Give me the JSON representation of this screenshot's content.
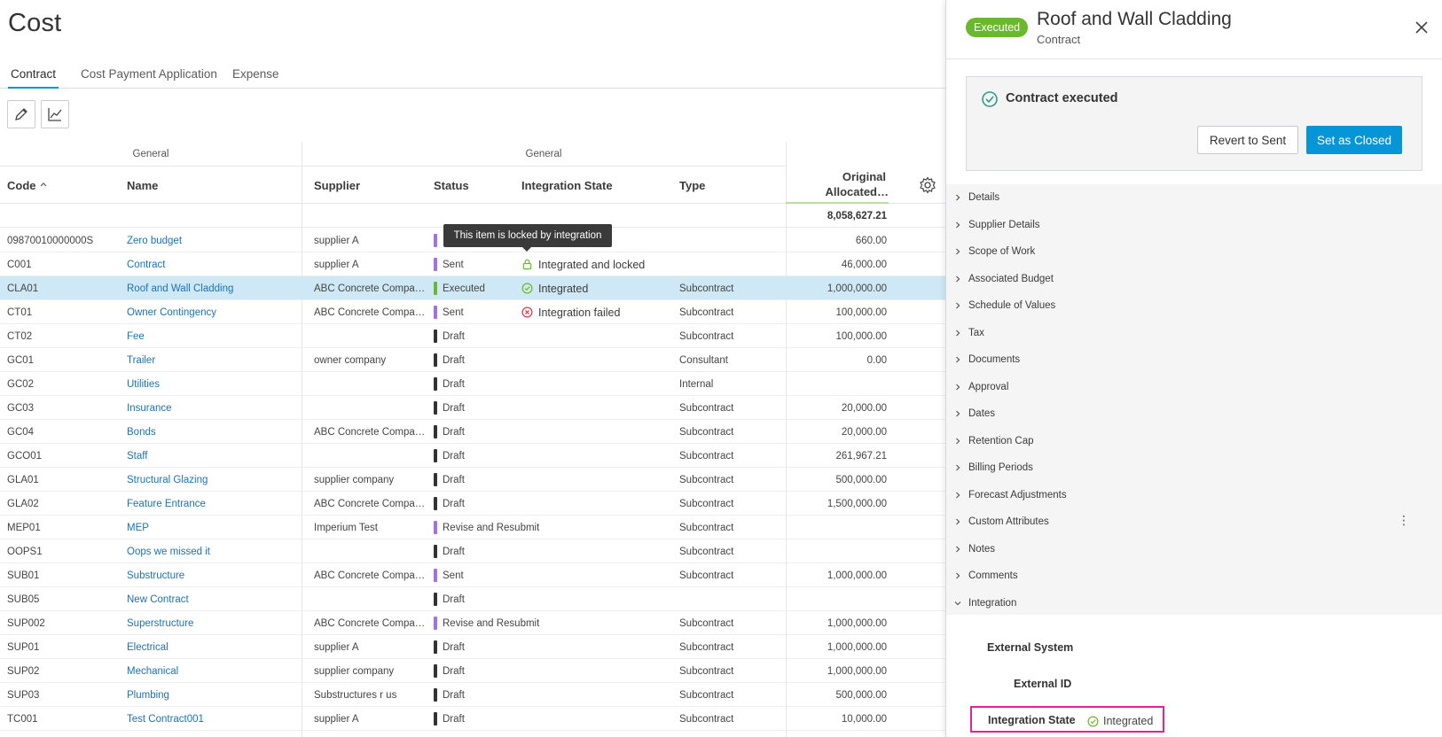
{
  "page": {
    "title": "Cost"
  },
  "tabs": [
    {
      "label": "Contract",
      "active": true
    },
    {
      "label": "Cost Payment Application",
      "active": false
    },
    {
      "label": "Expense",
      "active": false
    }
  ],
  "toolbar": {
    "edit_icon": "pencil-icon",
    "chart_icon": "chart-line-icon"
  },
  "grid": {
    "groups": [
      "General",
      "General"
    ],
    "columns": {
      "code": "Code",
      "name": "Name",
      "supplier": "Supplier",
      "status": "Status",
      "integration": "Integration State",
      "type": "Type",
      "original_1": "Original",
      "original_2": "Allocated…"
    },
    "total_original": "8,058,627.21",
    "rows": [
      {
        "code": "09870010000000S",
        "name": "Zero budget",
        "supplier": "supplier A",
        "status": "",
        "status_color": "#a66ee8",
        "integration": "",
        "int_icon": "",
        "type": "",
        "original": "660.00"
      },
      {
        "code": "C001",
        "name": "Contract",
        "supplier": "supplier A",
        "status": "Sent",
        "status_color": "#a66ee8",
        "integration": "Integrated and locked",
        "int_icon": "lock",
        "type": "",
        "original": "46,000.00"
      },
      {
        "code": "CLA01",
        "name": "Roof and Wall Cladding",
        "supplier": "ABC Concrete Compa…",
        "status": "Executed",
        "status_color": "#6ab82b",
        "integration": "Integrated",
        "int_icon": "check",
        "type": "Subcontract",
        "original": "1,000,000.00",
        "selected": true
      },
      {
        "code": "CT01",
        "name": "Owner Contingency",
        "supplier": "ABC Concrete Compa…",
        "status": "Sent",
        "status_color": "#a66ee8",
        "integration": "Integration failed",
        "int_icon": "error",
        "type": "Subcontract",
        "original": "100,000.00"
      },
      {
        "code": "CT02",
        "name": "Fee",
        "supplier": "",
        "status": "Draft",
        "status_color": "#333333",
        "integration": "",
        "int_icon": "",
        "type": "Subcontract",
        "original": "100,000.00"
      },
      {
        "code": "GC01",
        "name": "Trailer",
        "supplier": "owner company",
        "status": "Draft",
        "status_color": "#333333",
        "integration": "",
        "int_icon": "",
        "type": "Consultant",
        "original": "0.00"
      },
      {
        "code": "GC02",
        "name": "Utilities",
        "supplier": "",
        "status": "Draft",
        "status_color": "#333333",
        "integration": "",
        "int_icon": "",
        "type": "Internal",
        "original": ""
      },
      {
        "code": "GC03",
        "name": "Insurance",
        "supplier": "",
        "status": "Draft",
        "status_color": "#333333",
        "integration": "",
        "int_icon": "",
        "type": "Subcontract",
        "original": "20,000.00"
      },
      {
        "code": "GC04",
        "name": "Bonds",
        "supplier": "ABC Concrete Compa…",
        "status": "Draft",
        "status_color": "#333333",
        "integration": "",
        "int_icon": "",
        "type": "Subcontract",
        "original": "20,000.00"
      },
      {
        "code": "GCO01",
        "name": "Staff",
        "supplier": "",
        "status": "Draft",
        "status_color": "#333333",
        "integration": "",
        "int_icon": "",
        "type": "Subcontract",
        "original": "261,967.21"
      },
      {
        "code": "GLA01",
        "name": "Structural Glazing",
        "supplier": "supplier company",
        "status": "Draft",
        "status_color": "#333333",
        "integration": "",
        "int_icon": "",
        "type": "Subcontract",
        "original": "500,000.00"
      },
      {
        "code": "GLA02",
        "name": "Feature Entrance",
        "supplier": "ABC Concrete Compa…",
        "status": "Draft",
        "status_color": "#333333",
        "integration": "",
        "int_icon": "",
        "type": "Subcontract",
        "original": "1,500,000.00"
      },
      {
        "code": "MEP01",
        "name": "MEP",
        "supplier": "Imperium Test",
        "status": "Revise and Resubmit",
        "status_color": "#a66ee8",
        "integration": "",
        "int_icon": "",
        "type": "Subcontract",
        "original": ""
      },
      {
        "code": "OOPS1",
        "name": "Oops we missed it",
        "supplier": "",
        "status": "Draft",
        "status_color": "#333333",
        "integration": "",
        "int_icon": "",
        "type": "Subcontract",
        "original": ""
      },
      {
        "code": "SUB01",
        "name": "Substructure",
        "supplier": "ABC Concrete Compa…",
        "status": "Sent",
        "status_color": "#a66ee8",
        "integration": "",
        "int_icon": "",
        "type": "Subcontract",
        "original": "1,000,000.00"
      },
      {
        "code": "SUB05",
        "name": "New Contract",
        "supplier": "",
        "status": "Draft",
        "status_color": "#333333",
        "integration": "",
        "int_icon": "",
        "type": "",
        "original": ""
      },
      {
        "code": "SUP002",
        "name": "Superstructure",
        "supplier": "ABC Concrete Compa…",
        "status": "Revise and Resubmit",
        "status_color": "#a66ee8",
        "integration": "",
        "int_icon": "",
        "type": "Subcontract",
        "original": "1,000,000.00"
      },
      {
        "code": "SUP01",
        "name": "Electrical",
        "supplier": "supplier A",
        "status": "Draft",
        "status_color": "#333333",
        "integration": "",
        "int_icon": "",
        "type": "Subcontract",
        "original": "1,000,000.00"
      },
      {
        "code": "SUP02",
        "name": "Mechanical",
        "supplier": "supplier company",
        "status": "Draft",
        "status_color": "#333333",
        "integration": "",
        "int_icon": "",
        "type": "Subcontract",
        "original": "1,000,000.00"
      },
      {
        "code": "SUP03",
        "name": "Plumbing",
        "supplier": "Substructures r us",
        "status": "Draft",
        "status_color": "#333333",
        "integration": "",
        "int_icon": "",
        "type": "Subcontract",
        "original": "500,000.00"
      },
      {
        "code": "TC001",
        "name": "Test Contract001",
        "supplier": "supplier A",
        "status": "Draft",
        "status_color": "#333333",
        "integration": "",
        "int_icon": "",
        "type": "Subcontract",
        "original": "10,000.00"
      }
    ]
  },
  "tooltip": {
    "text": "This item is locked by integration"
  },
  "panel": {
    "badge": "Executed",
    "title": "Roof and Wall Cladding",
    "subtitle": "Contract",
    "exec_message": "Contract executed",
    "revert_button": "Revert to Sent",
    "close_button": "Set as Closed",
    "sections": [
      "Details",
      "Supplier Details",
      "Scope of Work",
      "Associated Budget",
      "Schedule of Values",
      "Tax",
      "Documents",
      "Approval",
      "Dates",
      "Retention Cap",
      "Billing Periods",
      "Forecast Adjustments",
      "Custom Attributes",
      "Notes",
      "Comments",
      "Integration"
    ],
    "integration": {
      "external_system_label": "External System",
      "external_id_label": "External ID",
      "state_label": "Integration State",
      "state_value": "Integrated"
    }
  },
  "colors": {
    "accent": "#0696d7",
    "executed": "#6ab82b",
    "sent": "#a66ee8",
    "draft": "#333333",
    "error": "#e0344a",
    "highlight": "#e0239a",
    "selected_row": "#cfe8f5"
  }
}
